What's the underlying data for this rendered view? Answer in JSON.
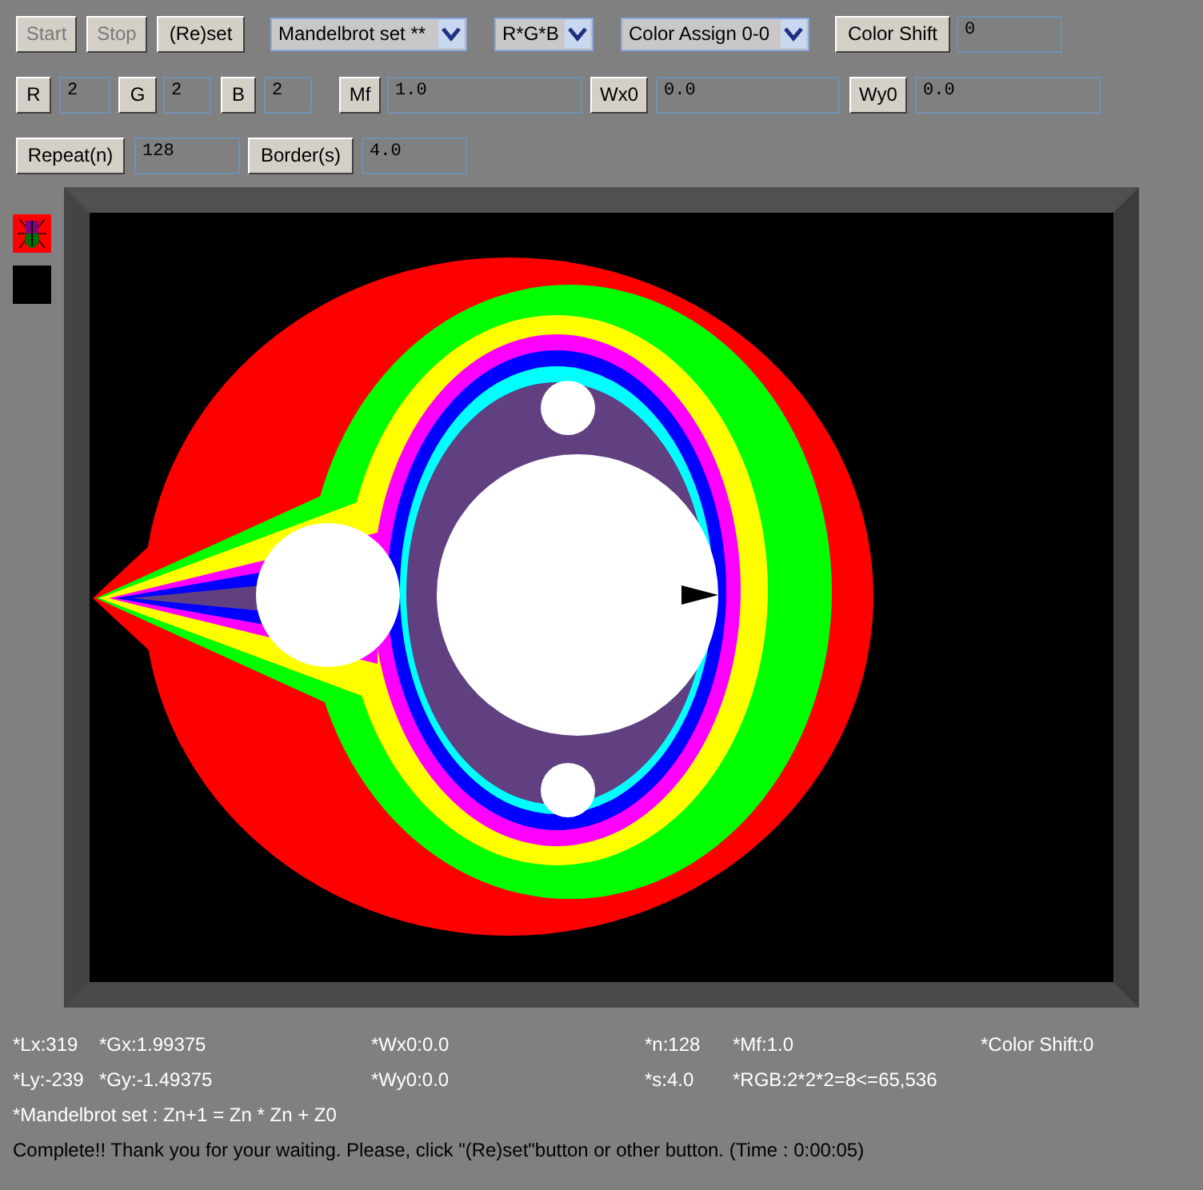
{
  "toolbar_rows": [
    [
      {
        "kind": "button",
        "label": "Start",
        "disabled": true
      },
      {
        "kind": "button",
        "label": "Stop",
        "disabled": true
      },
      {
        "kind": "button",
        "label": "(Re)set",
        "disabled": false
      },
      {
        "kind": "select",
        "value": "Mandelbrot set **"
      },
      {
        "kind": "select",
        "value": "R*G*B"
      },
      {
        "kind": "select",
        "value": "Color Assign 0-0"
      },
      {
        "kind": "button",
        "label": "Color Shift",
        "disabled": false
      },
      {
        "kind": "field",
        "value": "0"
      }
    ],
    [
      {
        "kind": "button",
        "label": "R",
        "disabled": false
      },
      {
        "kind": "field",
        "value": "2"
      },
      {
        "kind": "button",
        "label": "G",
        "disabled": false
      },
      {
        "kind": "field",
        "value": "2"
      },
      {
        "kind": "button",
        "label": "B",
        "disabled": false
      },
      {
        "kind": "field",
        "value": "2"
      },
      {
        "kind": "button",
        "label": "Mf",
        "disabled": false
      },
      {
        "kind": "field",
        "value": "1.0"
      },
      {
        "kind": "button",
        "label": "Wx0",
        "disabled": false
      },
      {
        "kind": "field",
        "value": "0.0"
      },
      {
        "kind": "button",
        "label": "Wy0",
        "disabled": false
      },
      {
        "kind": "field",
        "value": "0.0"
      }
    ],
    [
      {
        "kind": "button",
        "label": "Repeat(n)",
        "disabled": false
      },
      {
        "kind": "field",
        "value": "128"
      },
      {
        "kind": "button",
        "label": "Border(s)",
        "disabled": false
      },
      {
        "kind": "field",
        "value": "4.0"
      }
    ]
  ],
  "status_rows": [
    [
      "*Lx:319",
      "*Gx:1.99375",
      "*Wx0:0.0",
      "*n:128",
      "*Mf:1.0",
      "*Color Shift:0"
    ],
    [
      "*Ly:-239",
      "*Gy:-1.49375",
      "*Wy0:0.0",
      "*s:4.0",
      "*RGB:2*2*2=8<=65,536"
    ]
  ],
  "formula": "*Mandelbrot set : Zn+1 = Zn * Zn + Z0",
  "message": "Complete!! Thank you for your waiting. Please, click \"(Re)set\"button or other button. (Time : 0:00:05)"
}
